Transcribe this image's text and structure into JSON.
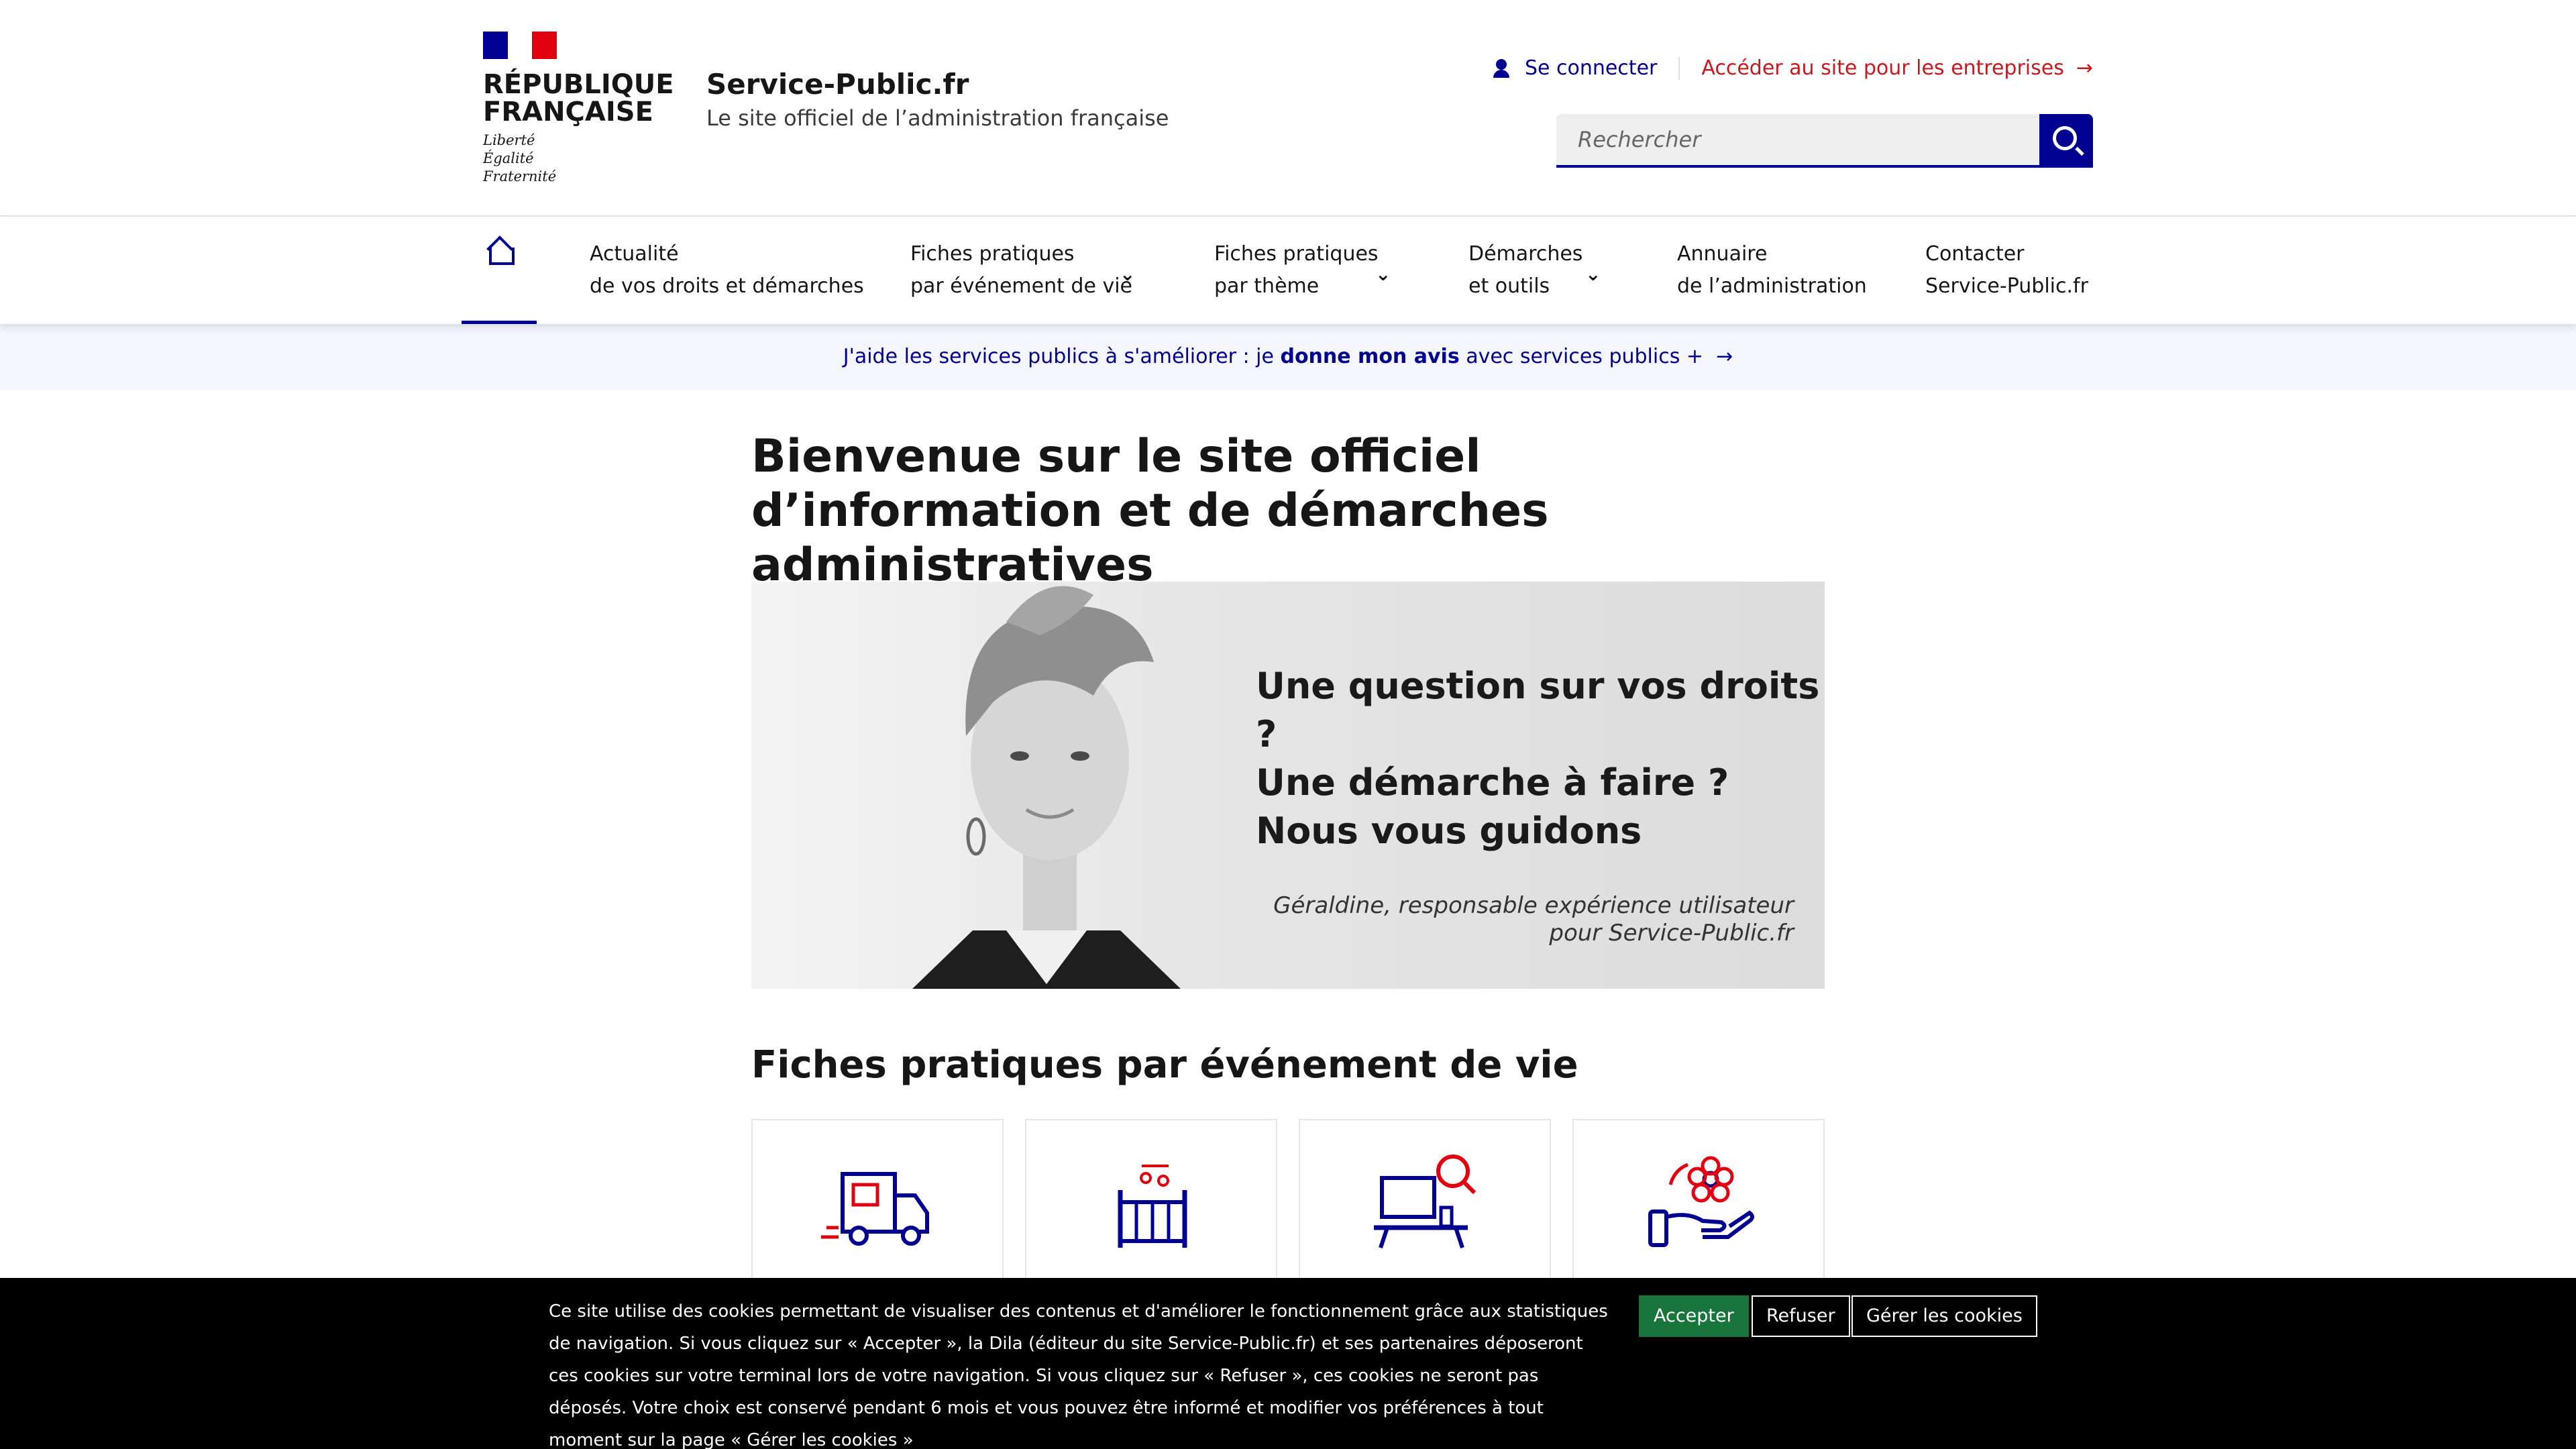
{
  "header": {
    "republic_name_line1": "RÉPUBLIQUE",
    "republic_name_line2": "FRANÇAISE",
    "motto_1": "Liberté",
    "motto_2": "Égalité",
    "motto_3": "Fraternité",
    "site_title": "Service-Public.fr",
    "site_tagline": "Le site officiel de l’administration française",
    "login_label": "Se connecter",
    "business_link": "Accéder au site pour les entreprises",
    "search_placeholder": "Rechercher"
  },
  "nav": {
    "items": [
      {
        "line1": "Actualité",
        "line2": "de vos droits et démarches",
        "dropdown": false
      },
      {
        "line1": "Fiches pratiques",
        "line2": "par événement de vie",
        "dropdown": true
      },
      {
        "line1": "Fiches pratiques",
        "line2": "par thème",
        "dropdown": true
      },
      {
        "line1": "Démarches",
        "line2": "et outils",
        "dropdown": true
      },
      {
        "line1": "Annuaire",
        "line2": "de l’administration",
        "dropdown": false
      },
      {
        "line1": "Contacter",
        "line2": "Service-Public.fr",
        "dropdown": false
      }
    ],
    "chevron": "⌄"
  },
  "notice": {
    "prefix": "J'aide les services publics à s'améliorer : je ",
    "bold": "donne mon avis",
    "suffix": " avec services publics +"
  },
  "main": {
    "heading": "Bienvenue sur le site officiel d’information et de démarches administratives",
    "hero": {
      "question_1": "Une question sur vos droits ?",
      "question_2": "Une démarche à faire ?",
      "question_3": "Nous vous guidons",
      "caption_1": "Géraldine, responsable expérience utilisateur",
      "caption_2": "pour Service-Public.fr"
    },
    "section_title": "Fiches pratiques par événement de vie",
    "cards": [
      {
        "icon": "moving-truck-icon"
      },
      {
        "icon": "baby-crib-icon"
      },
      {
        "icon": "job-search-desk-icon"
      },
      {
        "icon": "helping-hand-flower-icon"
      }
    ]
  },
  "cookie": {
    "text": "Ce site utilise des cookies permettant de visualiser des contenus et d'améliorer le fonctionnement grâce aux statistiques de navigation. Si vous cliquez sur « Accepter », la Dila (éditeur du site Service-Public.fr) et ses partenaires déposeront ces cookies sur votre terminal lors de votre navigation. Si vous cliquez sur « Refuser », ces cookies ne seront pas déposés. Votre choix est conservé pendant 6 mois et vous pouvez être informé et modifier vos préférences à tout moment sur la page « Gérer les cookies »",
    "accept": "Accepter",
    "refuse": "Refuser",
    "manage": "Gérer les cookies"
  },
  "colors": {
    "primary_blue": "#000091",
    "marianne_red": "#e1000f",
    "link_red": "#c9191e",
    "accept_green": "#18753c",
    "icon_red": "#e1000f"
  }
}
